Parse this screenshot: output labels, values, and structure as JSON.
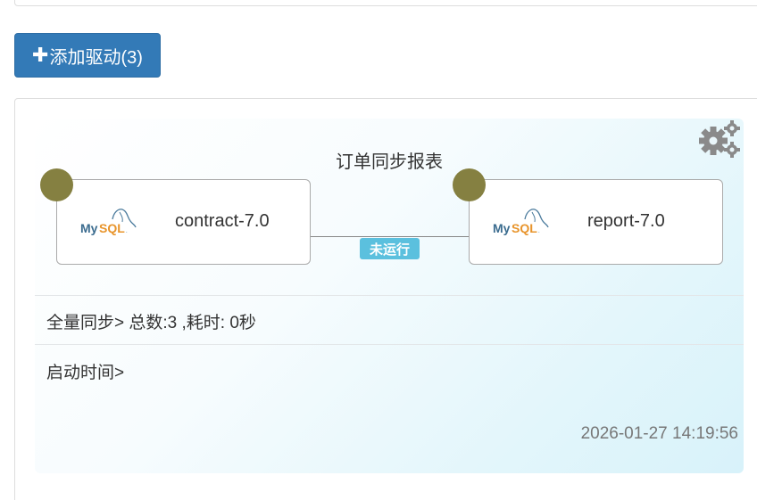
{
  "toolbar": {
    "add_driver_label": "添加驱动(3)"
  },
  "task": {
    "title": "订单同步报表",
    "source": {
      "type": "MySQL",
      "name": "contract-7.0"
    },
    "target": {
      "type": "MySQL",
      "name": "report-7.0"
    },
    "status": "未运行",
    "sync_info": "全量同步> 总数:3 ,耗时: 0秒",
    "start_time_label": "启动时间>",
    "updated_time": "2026-01-27 14:19:56"
  },
  "colors": {
    "primary_button": "#337ab7",
    "status_badge": "#5bc0de",
    "node_dot": "#858041"
  },
  "icons": [
    "plus-icon",
    "settings-gears-icon",
    "mysql-logo"
  ]
}
